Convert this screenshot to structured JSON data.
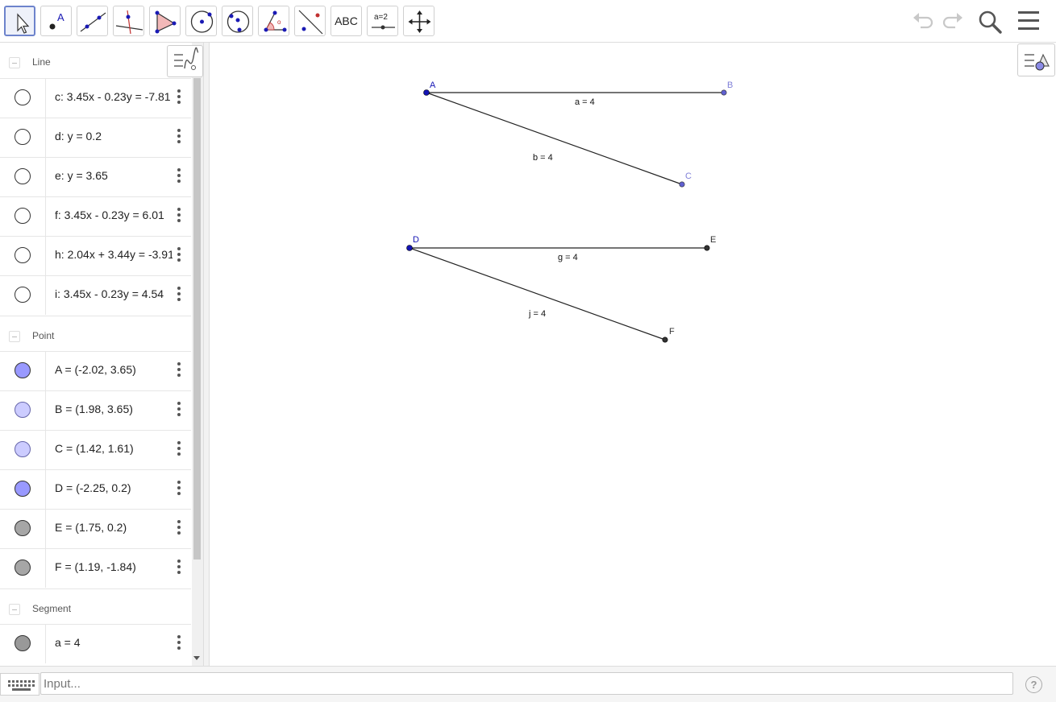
{
  "toolbar": {
    "tools": [
      {
        "name": "move-tool"
      },
      {
        "name": "point-tool",
        "label": "A"
      },
      {
        "name": "line-tool"
      },
      {
        "name": "perpendicular-line-tool"
      },
      {
        "name": "polygon-tool"
      },
      {
        "name": "circle-tool"
      },
      {
        "name": "circle-three-points-tool"
      },
      {
        "name": "angle-tool"
      },
      {
        "name": "reflect-tool"
      },
      {
        "name": "text-tool",
        "label": "ABC"
      },
      {
        "name": "slider-tool",
        "label": "a=2"
      },
      {
        "name": "move-graphics-tool"
      }
    ]
  },
  "algebra": {
    "groups": {
      "line": "Line",
      "point": "Point",
      "segment": "Segment"
    },
    "lines": [
      {
        "expr": "c: 3.45x - 0.23y = -7.81"
      },
      {
        "expr": "d: y = 0.2"
      },
      {
        "expr": "e: y = 3.65"
      },
      {
        "expr": "f: 3.45x - 0.23y = 6.01"
      },
      {
        "expr": "h: 2.04x + 3.44y = -3.91"
      },
      {
        "expr": "i: 3.45x - 0.23y = 4.54"
      }
    ],
    "points": [
      {
        "expr": "A = (-2.02, 3.65)",
        "color": "#9999ff"
      },
      {
        "expr": "B = (1.98, 3.65)",
        "color": "#ccccff"
      },
      {
        "expr": "C = (1.42, 1.61)",
        "color": "#ccccff"
      },
      {
        "expr": "D = (-2.25, 0.2)",
        "color": "#9999ff"
      },
      {
        "expr": "E = (1.75, 0.2)",
        "color": "#a6a6a6"
      },
      {
        "expr": "F = (1.19, -1.84)",
        "color": "#a6a6a6"
      }
    ],
    "segments": [
      {
        "expr": "a = 4",
        "color": "#999999"
      }
    ]
  },
  "graphics": {
    "points": {
      "A": "A",
      "B": "B",
      "C": "C",
      "D": "D",
      "E": "E",
      "F": "F"
    },
    "labels": {
      "a": "a = 4",
      "b": "b = 4",
      "g": "g = 4",
      "j": "j = 4"
    },
    "colors": {
      "free_point": "#1414b4",
      "dependent_point": "#6060d0",
      "dependent_label": "#8080d8",
      "dark_point": "#333333"
    }
  },
  "input": {
    "placeholder": "Input..."
  }
}
